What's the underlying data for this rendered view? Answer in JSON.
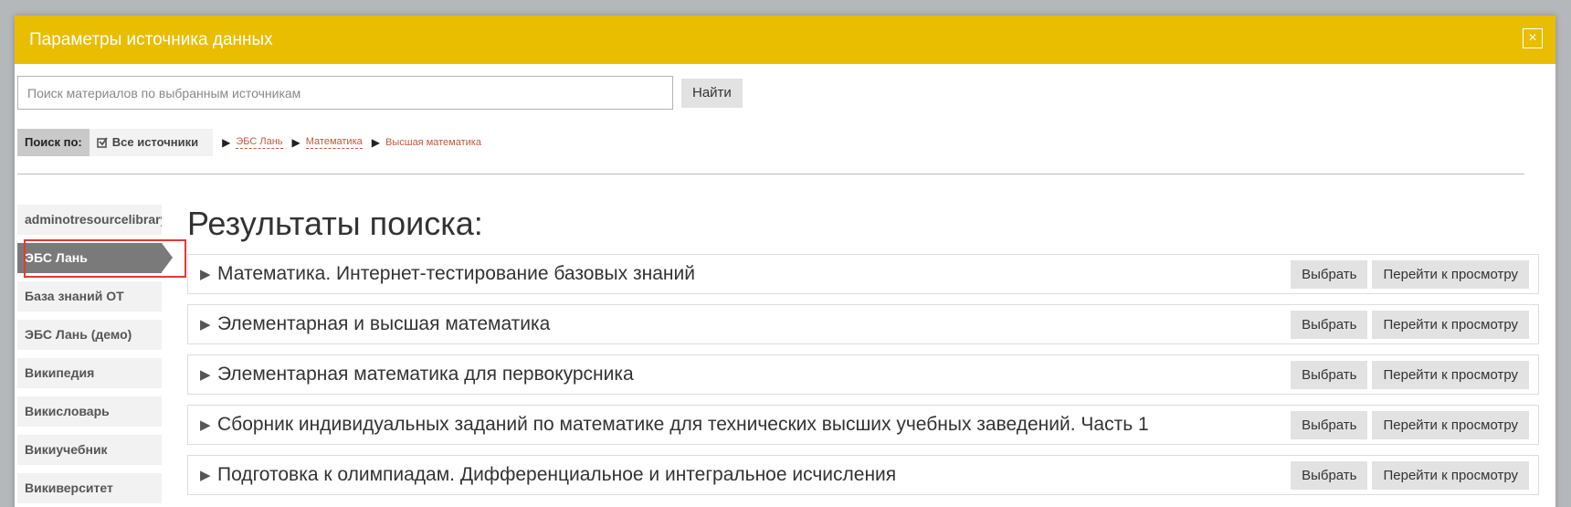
{
  "dialog": {
    "title": "Параметры источника данных",
    "close_symbol": "×"
  },
  "search": {
    "placeholder": "Поиск материалов по выбранным источникам",
    "value": "",
    "button_label": "Найти"
  },
  "filter": {
    "label": "Поиск по:",
    "all_sources_label": "Все источники",
    "arrow": "▶",
    "breadcrumb": [
      {
        "label": "ЭБС Лань",
        "link": true
      },
      {
        "label": "Математика",
        "link": true
      },
      {
        "label": "Высшая математика",
        "link": false
      }
    ]
  },
  "sidebar": {
    "items": [
      {
        "label": "adminotresourcelibrary",
        "active": false
      },
      {
        "label": "ЭБС Лань",
        "active": true
      },
      {
        "label": "База знаний ОТ",
        "active": false
      },
      {
        "label": "ЭБС Лань (демо)",
        "active": false
      },
      {
        "label": "Википедия",
        "active": false
      },
      {
        "label": "Викисловарь",
        "active": false
      },
      {
        "label": "Викиучебник",
        "active": false
      },
      {
        "label": "Викиверситет",
        "active": false
      }
    ]
  },
  "results": {
    "heading": "Результаты поиска:",
    "select_label": "Выбрать",
    "view_label": "Перейти к просмотру",
    "items": [
      {
        "title": "Математика. Интернет-тестирование базовых знаний"
      },
      {
        "title": "Элементарная и высшая математика"
      },
      {
        "title": "Элементарная математика для первокурсника"
      },
      {
        "title": "Сборник индивидуальных заданий по математике для технических высших учебных заведений. Часть 1"
      },
      {
        "title": "Подготовка к олимпиадам. Дифференциальное и интегральное исчисления"
      }
    ]
  },
  "colors": {
    "header": "#e9bd00",
    "active_sidebar": "#7a7a7a",
    "highlight": "#e53935",
    "link": "#c0573e"
  }
}
